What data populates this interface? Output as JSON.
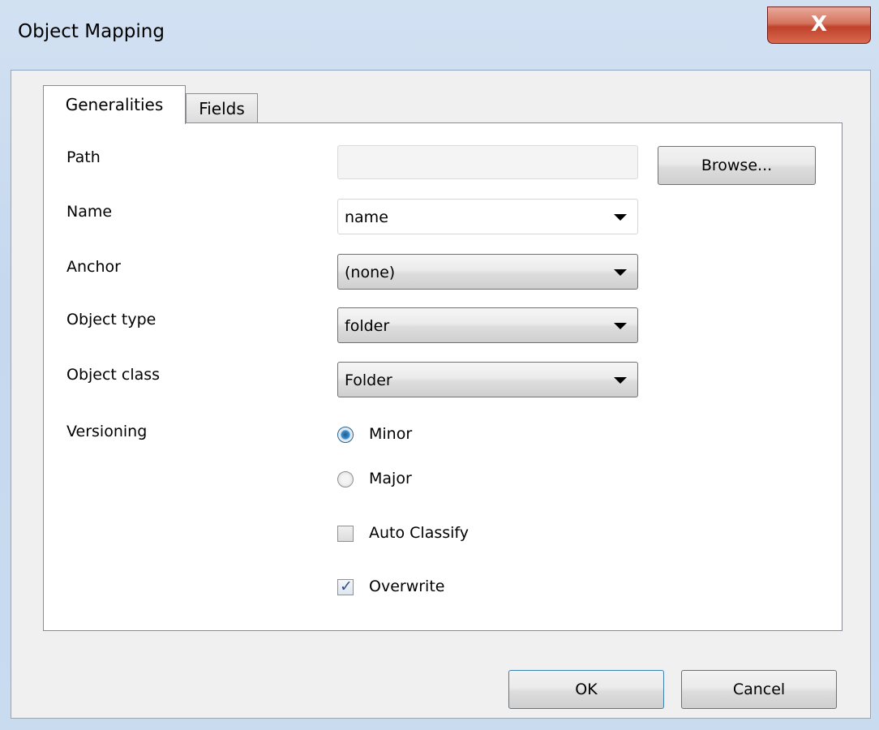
{
  "window": {
    "title": "Object Mapping",
    "close_glyph": "X"
  },
  "tabs": [
    {
      "label": "Generalities",
      "active": true
    },
    {
      "label": "Fields",
      "active": false
    }
  ],
  "form": {
    "path": {
      "label": "Path",
      "value": ""
    },
    "browse_label": "Browse...",
    "name": {
      "label": "Name",
      "value": "name"
    },
    "anchor": {
      "label": "Anchor",
      "value": "(none)"
    },
    "object_type": {
      "label": "Object type",
      "value": "folder"
    },
    "object_class": {
      "label": "Object class",
      "value": "Folder"
    },
    "versioning": {
      "label": "Versioning",
      "options": [
        {
          "label": "Minor",
          "selected": true
        },
        {
          "label": "Major",
          "selected": false
        }
      ]
    },
    "auto_classify": {
      "label": "Auto Classify",
      "checked": false
    },
    "overwrite": {
      "label": "Overwrite",
      "checked": true
    }
  },
  "footer": {
    "ok_label": "OK",
    "cancel_label": "Cancel"
  },
  "colors": {
    "accent": "#3a8ccf",
    "close_button": "#c0412a"
  }
}
